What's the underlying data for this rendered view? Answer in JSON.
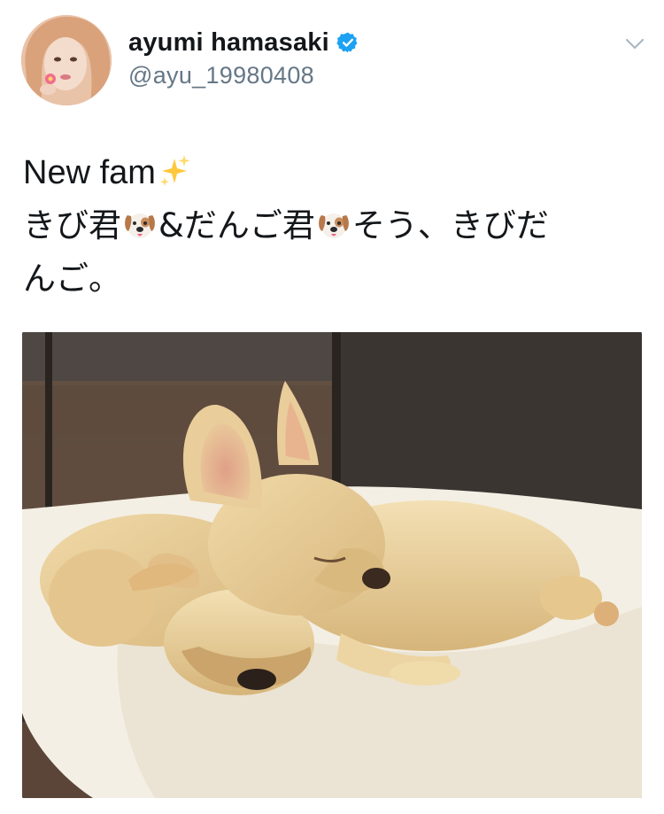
{
  "user": {
    "display_name": "ayumi hamasaki",
    "handle": "@ayu_19980408",
    "verified": true,
    "verified_icon": "verified-badge-icon",
    "avatar_icon": "avatar"
  },
  "menu": {
    "icon": "chevron-down-icon"
  },
  "tweet": {
    "line1_text": "New fam",
    "line1_emoji": "sparkles-icon",
    "line2_part1": "きび君",
    "line2_emoji1": "dog-face-icon",
    "line2_part2": "&だんご君",
    "line2_emoji2": "dog-face-icon",
    "line2_part3": "そう、きびだ",
    "line3_text": "んご。"
  },
  "media": {
    "type": "photo",
    "icon": "photo-two-puppies-sleeping"
  },
  "colors": {
    "text": "#14171a",
    "secondary": "#657786",
    "verified": "#1da1f2"
  }
}
